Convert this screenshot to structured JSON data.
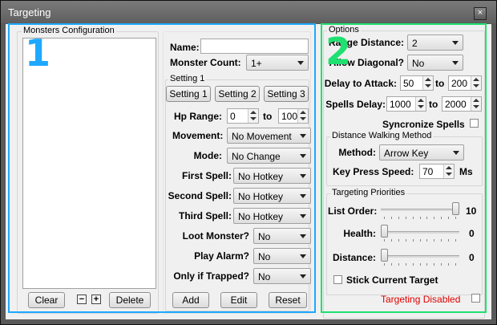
{
  "window": {
    "title": "Targeting",
    "close_glyph": "×"
  },
  "overlay": {
    "left_number": "1",
    "right_number": "2",
    "left_color": "#1ea8ff",
    "right_color": "#1fe070"
  },
  "left": {
    "group_label": "Monsters Configuration",
    "buttons": {
      "clear": "Clear",
      "minus": "−",
      "plus": "+",
      "delete": "Delete",
      "add": "Add",
      "edit": "Edit",
      "reset": "Reset"
    },
    "name_label": "Name:",
    "name_value": "",
    "monster_count_label": "Monster Count:",
    "monster_count_value": "1+",
    "setting_group_label": "Setting 1",
    "setting_tabs": [
      "Setting 1",
      "Setting 2",
      "Setting 3"
    ],
    "hp_range_label": "Hp Range:",
    "hp_from": "0",
    "hp_to_label": "to",
    "hp_to": "100",
    "rows": [
      {
        "label": "Movement:",
        "value": "No Movement"
      },
      {
        "label": "Mode:",
        "value": "No Change"
      },
      {
        "label": "First Spell:",
        "value": "No Hotkey"
      },
      {
        "label": "Second Spell:",
        "value": "No Hotkey"
      },
      {
        "label": "Third Spell:",
        "value": "No Hotkey"
      }
    ],
    "small_rows": [
      {
        "label": "Loot Monster?",
        "value": "No"
      },
      {
        "label": "Play Alarm?",
        "value": "No"
      },
      {
        "label": "Only if Trapped?",
        "value": "No"
      }
    ]
  },
  "right": {
    "options_label": "Options",
    "range_distance_label": "Range Distance:",
    "range_distance_value": "2",
    "allow_diagonal_label": "Allow Diagonal?",
    "allow_diagonal_value": "No",
    "delay_attack_label": "Delay to Attack:",
    "delay_from": "50",
    "to_label": "to",
    "delay_to": "200",
    "spells_delay_label": "Spells Delay:",
    "spells_from": "1000",
    "spells_to": "2000",
    "sync_spells_label": "Syncronize Spells",
    "walking_group_label": "Distance Walking Method",
    "method_label": "Method:",
    "method_value": "Arrow Key",
    "key_speed_label": "Key Press Speed:",
    "key_speed_value": "70",
    "key_speed_unit": "Ms",
    "priorities_group_label": "Targeting Priorities",
    "list_order_label": "List Order:",
    "list_order_value": "10",
    "list_order_level": 1.0,
    "health_label": "Health:",
    "health_value": "0",
    "health_level": 0.0,
    "distance_label": "Distance:",
    "distance_value": "0",
    "distance_level": 0.0,
    "stick_target_label": "Stick Current Target",
    "status_text": "Targeting Disabled",
    "status_color": "#e00000"
  }
}
